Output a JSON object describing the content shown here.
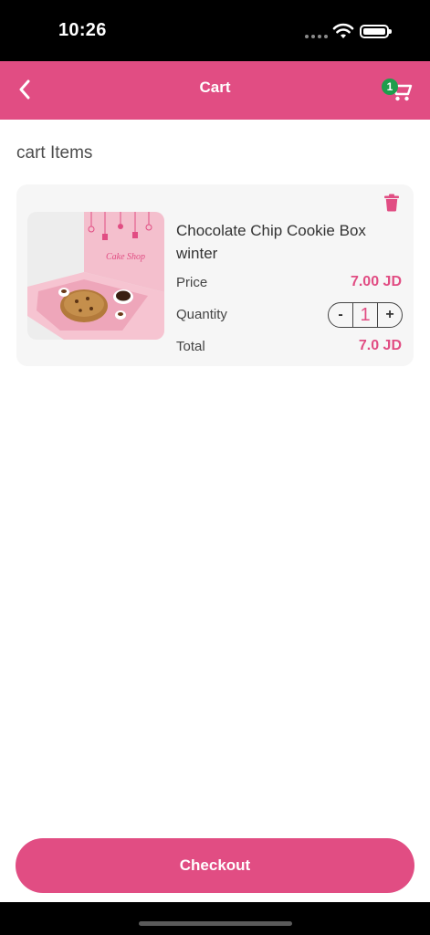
{
  "status_bar": {
    "time": "10:26"
  },
  "header": {
    "title": "Cart",
    "cart_count": "1"
  },
  "section": {
    "title": "cart Items"
  },
  "cart_item": {
    "name": "Chocolate Chip Cookie Box winter",
    "price_label": "Price",
    "price_value": "7.00 JD",
    "quantity_label": "Quantity",
    "quantity_value": "1",
    "minus": "-",
    "plus": "+",
    "total_label": "Total",
    "total_value": "7.0 JD",
    "image_brand_text": "Cake Shop"
  },
  "checkout": {
    "label": "Checkout"
  },
  "colors": {
    "accent": "#e14d83",
    "badge": "#1e9e4c",
    "card_bg": "#f6f6f6"
  },
  "icons": {
    "back": "chevron-left-icon",
    "cart": "cart-icon",
    "delete": "trash-icon"
  }
}
